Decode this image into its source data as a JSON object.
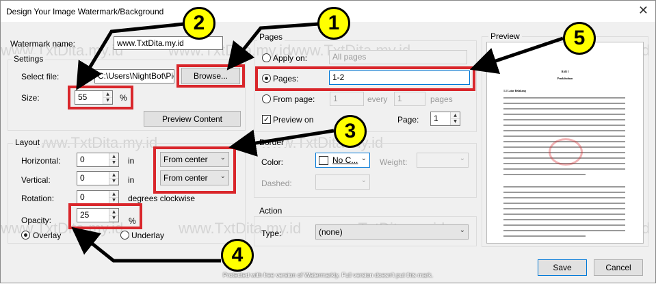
{
  "window": {
    "title": "Design Your Image Watermark/Background",
    "close": "✕"
  },
  "watermark": {
    "name_label": "Watermark name:",
    "name_value": "www.TxtDita.my.id"
  },
  "settings": {
    "group_title": "Settings",
    "select_file_label": "Select file:",
    "file_path": "C:\\Users\\NightBot\\Pic",
    "browse_label": "Browse...",
    "size_label": "Size:",
    "size_value": "55",
    "size_unit": "%",
    "preview_content_label": "Preview  Content"
  },
  "layout": {
    "group_title": "Layout",
    "horizontal_label": "Horizontal:",
    "horizontal_value": "0",
    "horizontal_unit": "in",
    "horizontal_from": "From center",
    "vertical_label": "Vertical:",
    "vertical_value": "0",
    "vertical_unit": "in",
    "vertical_from": "From center",
    "rotation_label": "Rotation:",
    "rotation_value": "0",
    "rotation_unit": "degrees clockwise",
    "opacity_label": "Opacity:",
    "opacity_value": "25",
    "opacity_unit": "%",
    "overlay_label": "Overlay",
    "underlay_label": "Underlay"
  },
  "pages": {
    "group_title": "Pages",
    "apply_on_label": "Apply on:",
    "apply_on_value": "All pages",
    "pages_label": "Pages:",
    "pages_value": "1-2",
    "from_page_label": "From page:",
    "from_value": "1",
    "every_label": "every",
    "every_value": "1",
    "pages_unit": "pages",
    "preview_on_label": "Preview on",
    "page_label": "Page:",
    "page_value": "1"
  },
  "border": {
    "group_title": "Border",
    "color_label": "Color:",
    "color_value": "No C...",
    "weight_label": "Weight:",
    "dashed_label": "Dashed:"
  },
  "action": {
    "group_title": "Action",
    "type_label": "Type:",
    "type_value": "(none)"
  },
  "preview": {
    "title": "Preview",
    "doc_heading1": "BAB I",
    "doc_heading2": "Pendahuluan",
    "doc_section": "1.1 Latar Belakang"
  },
  "buttons": {
    "save": "Save",
    "cancel": "Cancel"
  },
  "badges": {
    "b1": "1",
    "b2": "2",
    "b3": "3",
    "b4": "4",
    "b5": "5"
  },
  "watermark_overlay": "www.TxtDita.my.id",
  "footer": "Protected with free version of Watermarkly. Full version doesn't put this mark.",
  "colors": {
    "highlight": "#d9262b",
    "badge": "#ffff00"
  }
}
